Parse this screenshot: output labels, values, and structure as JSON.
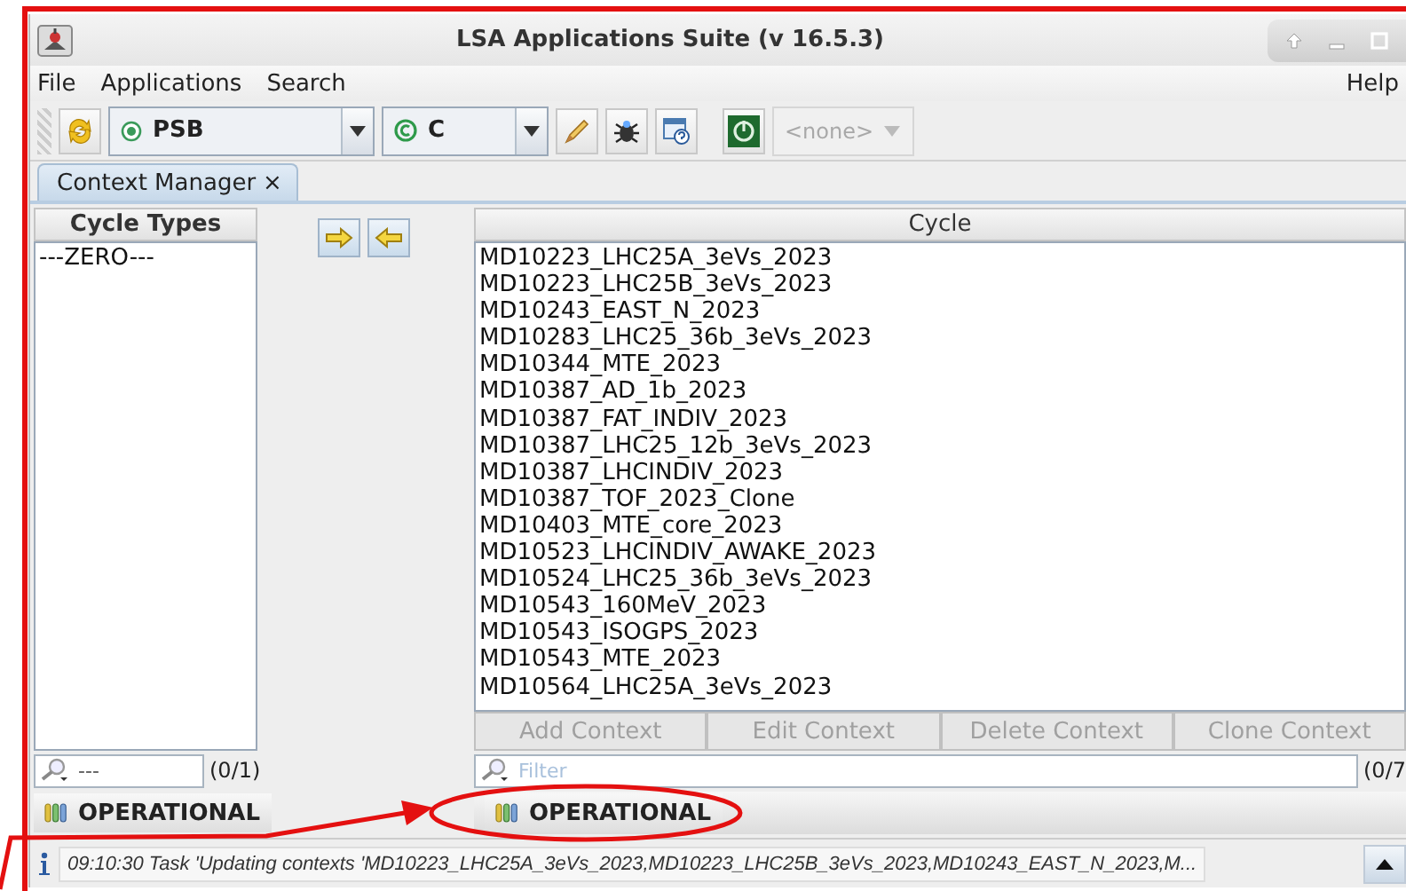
{
  "window": {
    "title": "LSA Applications Suite (v 16.5.3)"
  },
  "menu": [
    {
      "label": "File"
    },
    {
      "label": "Applications"
    },
    {
      "label": "Search"
    }
  ],
  "help_menu": {
    "label": "Help"
  },
  "toolbar": {
    "accelerator": {
      "label": "PSB"
    },
    "particle": {
      "label": "C"
    },
    "selector": {
      "label": "<none>",
      "disabled": true
    }
  },
  "tabs": [
    {
      "label": "Context Manager",
      "close": "×",
      "selected": true
    }
  ],
  "cycle_types": {
    "header": "Cycle Types",
    "items": [
      "---ZERO---"
    ],
    "filter_value": "---",
    "count": "(0/1)",
    "mode_button": "OPERATIONAL"
  },
  "cycles": {
    "header": "Cycle",
    "items": [
      "MD10223_LHC25A_3eVs_2023",
      "MD10223_LHC25B_3eVs_2023",
      "MD10243_EAST_N_2023",
      "MD10283_LHC25_36b_3eVs_2023",
      "MD10344_MTE_2023",
      "MD10387_AD_1b_2023",
      "MD10387_FAT_INDIV_2023",
      "MD10387_LHC25_12b_3eVs_2023",
      "MD10387_LHCINDIV_2023",
      "MD10387_TOF_2023_Clone",
      "MD10403_MTE_core_2023",
      "MD10523_LHCINDIV_AWAKE_2023",
      "MD10524_LHC25_36b_3eVs_2023",
      "MD10543_160MeV_2023",
      "MD10543_ISOGPS_2023",
      "MD10543_MTE_2023",
      "MD10564_LHC25A_3eVs_2023"
    ],
    "buttons": [
      {
        "label": "Add Context",
        "disabled": true
      },
      {
        "label": "Edit Context",
        "disabled": true
      },
      {
        "label": "Delete Context",
        "disabled": true
      },
      {
        "label": "Clone Context",
        "disabled": true
      }
    ],
    "filter_placeholder": "Filter",
    "count": "(0/7",
    "mode_button": "OPERATIONAL"
  },
  "status_bar": {
    "message": "09:10:30 Task 'Updating contexts 'MD10223_LHC25A_3eVs_2023,MD10223_LHC25B_3eVs_2023,MD10243_EAST_N_2023,M..."
  }
}
